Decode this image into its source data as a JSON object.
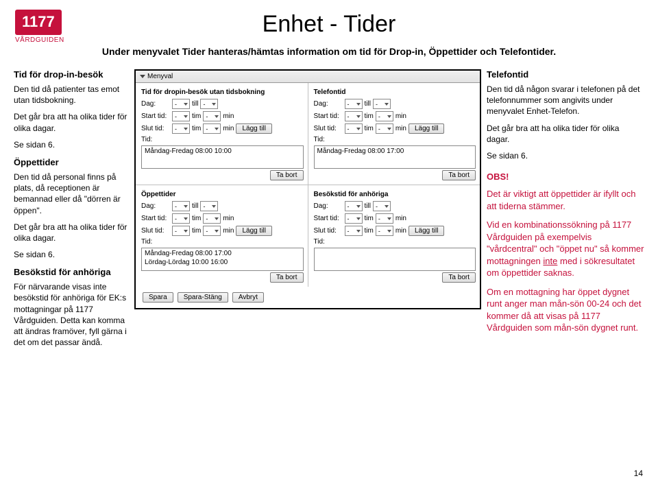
{
  "logo": {
    "brand": "1177",
    "sub": "VÅRDGUIDEN"
  },
  "title": "Enhet - Tider",
  "intro": "Under menyvalet Tider hanteras/hämtas information om tid för Drop-in, Öppettider och Telefontider.",
  "left": {
    "dropin": {
      "h": "Tid för drop-in-besök",
      "p1": "Den tid då patienter tas emot utan tidsbokning.",
      "p2": "Det går bra att ha olika tider för olika dagar.",
      "p3": "Se sidan 6."
    },
    "open": {
      "h": "Öppettider",
      "p1": "Den tid då personal finns på plats, då receptionen är bemannad eller då \"dörren är öppen\".",
      "p2": "Det går bra att ha olika tider för olika dagar.",
      "p3": "Se sidan 6."
    },
    "rel": {
      "h": "Besökstid för anhöriga",
      "p1": "För närvarande visas inte besökstid för anhöriga för EK:s mottagningar på 1177 Vårdguiden. Detta kan komma att ändras framöver, fyll gärna i det om det passar ändå."
    }
  },
  "right": {
    "tel": {
      "h": "Telefontid",
      "p1": "Den tid då någon svarar i telefonen på det telefonnummer som angivits under menyvalet Enhet-Telefon.",
      "p2": "Det går bra att ha olika tider för olika dagar.",
      "p3": "Se sidan 6."
    },
    "obs": {
      "h": "OBS!",
      "p1": "Det är viktigt att öppettider är ifyllt och att tiderna stämmer.",
      "p2a": "Vid en kombinationssökning på 1177 Vårdguiden på exempelvis \"vårdcentral\" och \"öppet nu\" så kommer mottagningen ",
      "p2b": "inte",
      "p2c": " med i sökresultatet om öppettider saknas.",
      "p3": "Om en mottagning har öppet dygnet runt anger man mån-sön 00-24 och det kommer då att visas på 1177 Vårdguiden som mån-sön dygnet runt."
    }
  },
  "shot": {
    "menu": "Menyval",
    "sel_dash": "-",
    "labels": {
      "dag": "Dag:",
      "start": "Start tid:",
      "slut": "Slut tid:",
      "tid": "Tid:",
      "till": "till",
      "tim": "tim",
      "min": "min",
      "lagg": "Lägg till",
      "tabort": "Ta bort"
    },
    "titles": {
      "dropin": "Tid för dropin-besök utan tidsbokning",
      "telefon": "Telefontid",
      "open": "Öppettider",
      "rel": "Besökstid för anhöriga"
    },
    "lists": {
      "dropin": "Måndag-Fredag 08:00 10:00",
      "telefon": "Måndag-Fredag 08:00 17:00",
      "open": "Måndag-Fredag 08:00 17:00\nLördag-Lördag 10:00 16:00",
      "rel": ""
    },
    "footer": {
      "spara": "Spara",
      "sparastang": "Spara-Stäng",
      "avbryt": "Avbryt"
    }
  },
  "pagenum": "14"
}
